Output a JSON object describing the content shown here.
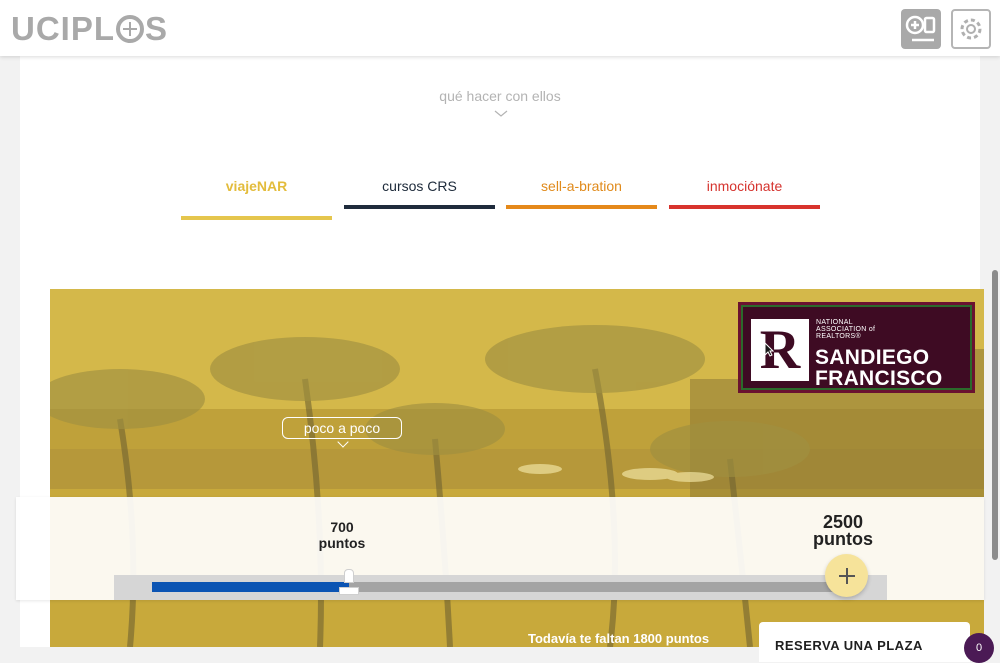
{
  "header": {
    "logo_left": "UCIPL",
    "logo_right": "S",
    "add_icon": "add-device-icon",
    "settings_icon": "gear-icon"
  },
  "hint": {
    "text": "qué hacer con ellos",
    "icon": "chevron-down-icon"
  },
  "tabs": [
    {
      "label": "viajeNAR",
      "color": "#e3bc3c",
      "active": true
    },
    {
      "label": "cursos CRS",
      "color": "#1d2a3a",
      "active": false
    },
    {
      "label": "sell-a-bration",
      "color": "#e08a1b",
      "active": false
    },
    {
      "label": "inmociónate",
      "color": "#d5332e",
      "active": false
    }
  ],
  "hero": {
    "badge": {
      "small_line1": "NATIONAL",
      "small_line2": "ASSOCIATION of",
      "small_line3": "REALTORS®",
      "big_line1": "SANDIEGO",
      "big_line2": "FRANCISCO",
      "letter": "R"
    },
    "tooltip": "poco a poco"
  },
  "slider": {
    "current_value": "700",
    "current_unit": "puntos",
    "goal_value": "2500",
    "goal_unit": "puntos",
    "progress_fraction": 0.28,
    "plus_icon": "plus-icon"
  },
  "footer": {
    "remaining_text": "Todavía te faltan 1800 puntos",
    "reserve_label": "RESERVA UNA PLAZA",
    "chat_badge": "0"
  }
}
